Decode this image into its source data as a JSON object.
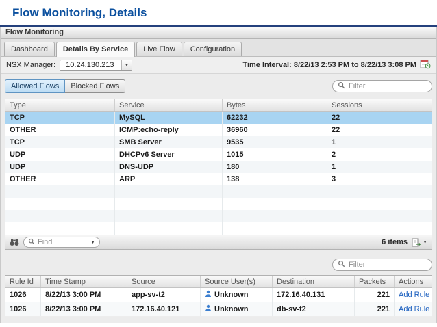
{
  "page": {
    "title": "Flow Monitoring, Details"
  },
  "window": {
    "title": "Flow Monitoring"
  },
  "tabs": [
    {
      "label": "Dashboard"
    },
    {
      "label": "Details By Service"
    },
    {
      "label": "Live Flow"
    },
    {
      "label": "Configuration"
    }
  ],
  "nsx_manager": {
    "label": "NSX Manager:",
    "value": "10.24.130.213"
  },
  "time_interval": {
    "label": "Time Interval:",
    "value": "8/22/13 2:53 PM to 8/22/13 3:08 PM"
  },
  "flow_toggle": {
    "allowed": "Allowed Flows",
    "blocked": "Blocked Flows"
  },
  "flows_table": {
    "filter_placeholder": "Filter",
    "columns": [
      "Type",
      "Service",
      "Bytes",
      "Sessions"
    ],
    "rows": [
      {
        "type": "TCP",
        "service": "MySQL",
        "bytes": "62232",
        "sessions": "22"
      },
      {
        "type": "OTHER",
        "service": "ICMP:echo-reply",
        "bytes": "36960",
        "sessions": "22"
      },
      {
        "type": "TCP",
        "service": "SMB Server",
        "bytes": "9535",
        "sessions": "1"
      },
      {
        "type": "UDP",
        "service": "DHCPv6 Server",
        "bytes": "1015",
        "sessions": "2"
      },
      {
        "type": "UDP",
        "service": "DNS-UDP",
        "bytes": "180",
        "sessions": "1"
      },
      {
        "type": "OTHER",
        "service": "ARP",
        "bytes": "138",
        "sessions": "3"
      }
    ],
    "footer": {
      "find_placeholder": "Find",
      "items_count": "6 items"
    }
  },
  "rules_table": {
    "filter_placeholder": "Filter",
    "columns": [
      "Rule Id",
      "Time Stamp",
      "Source",
      "Source User(s)",
      "Destination",
      "Packets",
      "Actions"
    ],
    "rows": [
      {
        "rule_id": "1026",
        "time_stamp": "8/22/13 3:00 PM",
        "source": "app-sv-t2",
        "source_user": "Unknown",
        "destination": "172.16.40.131",
        "packets": "221",
        "action": "Add Rule"
      },
      {
        "rule_id": "1026",
        "time_stamp": "8/22/13 3:00 PM",
        "source": "172.16.40.121",
        "source_user": "Unknown",
        "destination": "db-sv-t2",
        "packets": "221",
        "action": "Add Rule"
      }
    ]
  }
}
